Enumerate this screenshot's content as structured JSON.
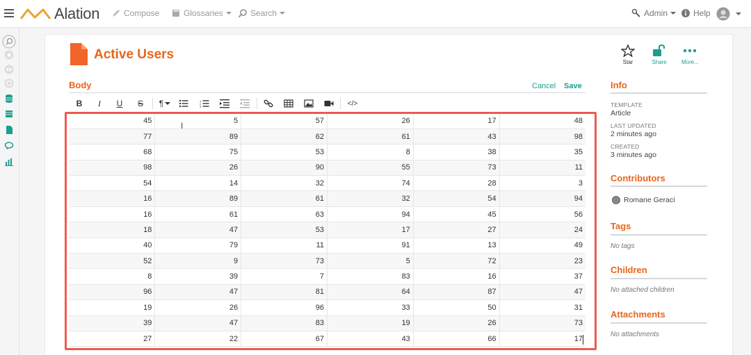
{
  "app": {
    "brand": "Alation",
    "nav": {
      "compose": "Compose",
      "glossaries": "Glossaries",
      "search": "Search",
      "admin": "Admin",
      "help": "Help"
    }
  },
  "article": {
    "title": "Active Users",
    "body_label": "Body",
    "cancel_label": "Cancel",
    "save_label": "Save",
    "actions": {
      "star": "Star",
      "share": "Share",
      "more": "More..."
    },
    "table_rows": [
      [
        "45",
        "5",
        "57",
        "26",
        "17",
        "48"
      ],
      [
        "77",
        "89",
        "62",
        "61",
        "43",
        "98"
      ],
      [
        "68",
        "75",
        "53",
        "8",
        "38",
        "35"
      ],
      [
        "98",
        "26",
        "90",
        "55",
        "73",
        "11"
      ],
      [
        "54",
        "14",
        "32",
        "74",
        "28",
        "3"
      ],
      [
        "16",
        "89",
        "61",
        "32",
        "54",
        "94"
      ],
      [
        "16",
        "61",
        "63",
        "94",
        "45",
        "56"
      ],
      [
        "18",
        "47",
        "53",
        "17",
        "27",
        "24"
      ],
      [
        "40",
        "79",
        "11",
        "91",
        "13",
        "49"
      ],
      [
        "52",
        "9",
        "73",
        "5",
        "72",
        "23"
      ],
      [
        "8",
        "39",
        "7",
        "83",
        "16",
        "37"
      ],
      [
        "96",
        "47",
        "81",
        "64",
        "87",
        "47"
      ],
      [
        "19",
        "26",
        "96",
        "33",
        "50",
        "31"
      ],
      [
        "39",
        "47",
        "83",
        "19",
        "26",
        "73"
      ],
      [
        "27",
        "22",
        "67",
        "43",
        "66",
        "17"
      ]
    ]
  },
  "toolbar": {
    "bold": "B",
    "italic": "I",
    "underline": "U",
    "strike": "S",
    "paragraph": "¶",
    "code": "</>"
  },
  "info": {
    "heading": "Info",
    "template_key": "TEMPLATE",
    "template_value": "Article",
    "updated_key": "LAST UPDATED",
    "updated_value": "2 minutes ago",
    "created_key": "CREATED",
    "created_value": "3 minutes ago"
  },
  "contributors": {
    "heading": "Contributors",
    "name": "Romane Geraci"
  },
  "tags": {
    "heading": "Tags",
    "empty": "No tags"
  },
  "children": {
    "heading": "Children",
    "empty": "No attached children"
  },
  "attachments": {
    "heading": "Attachments",
    "empty": "No attachments"
  },
  "colors": {
    "accent": "#e8651b",
    "link": "#1a9f8c",
    "highlight": "#ee5a4f"
  }
}
